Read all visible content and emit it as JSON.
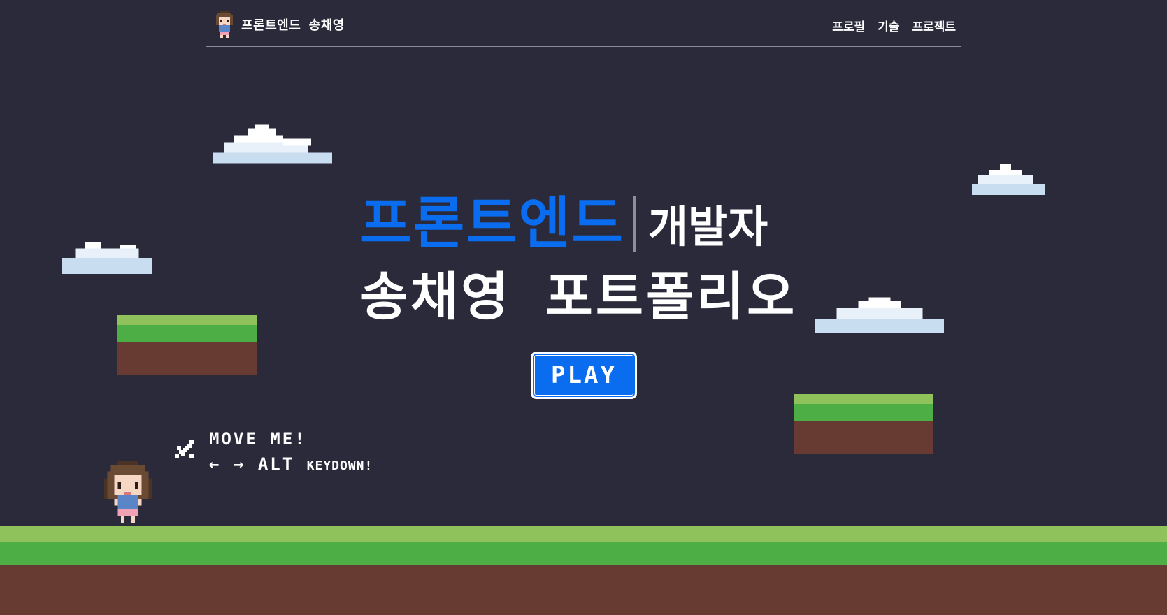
{
  "header": {
    "logo_text": "프론트엔드 송채영",
    "menu": [
      "프로필",
      "기술",
      "프로젝트"
    ]
  },
  "hero": {
    "title_highlight": "프론트엔드",
    "title_rest": "개발자",
    "subtitle": "송채영 포트폴리오",
    "play_label": "PLAY"
  },
  "hint": {
    "line1": "MOVE ME!",
    "arrows": "← →",
    "key": "ALT",
    "key_suffix": "KEYDOWN!"
  },
  "colors": {
    "background": "#2b2a3b",
    "accent": "#0a6df0",
    "grass_light": "#8fc25a",
    "grass": "#4cae45",
    "dirt": "#673a32"
  },
  "icons": [
    "character-avatar-icon",
    "cloud-icon",
    "sword-icon"
  ]
}
